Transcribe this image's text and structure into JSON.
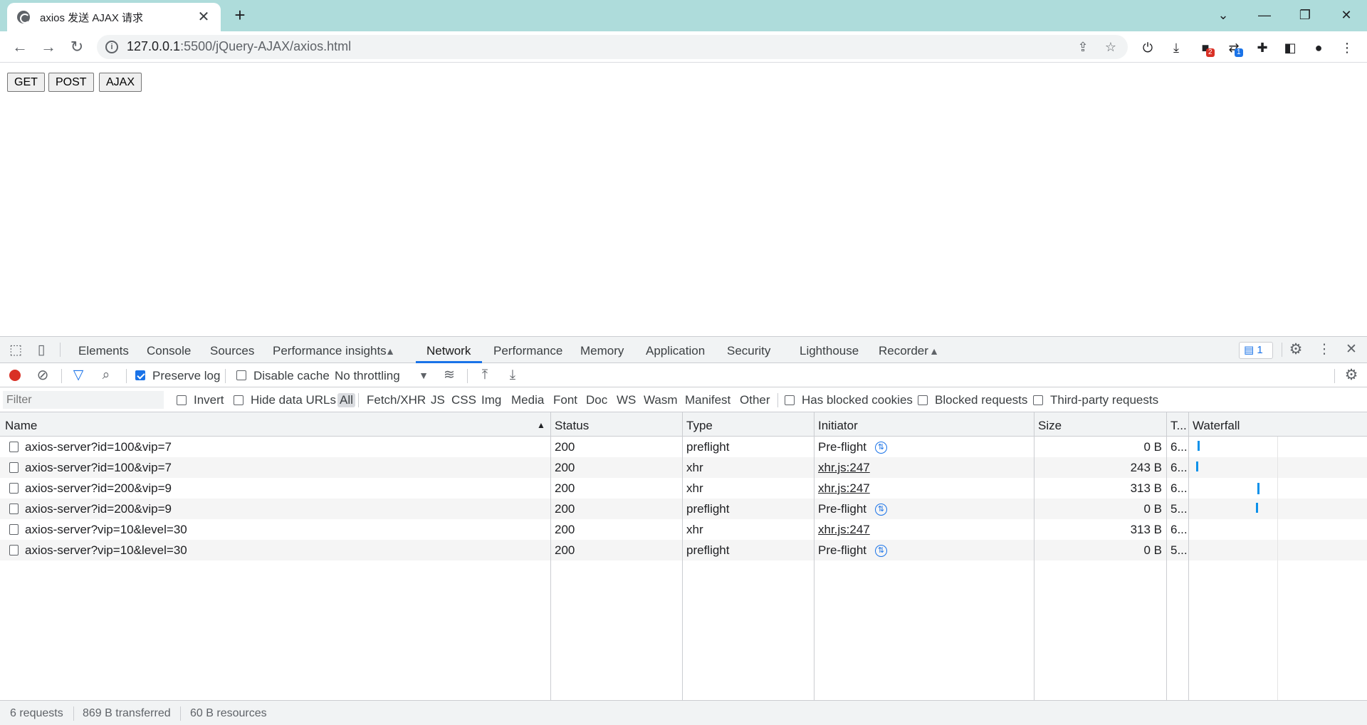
{
  "browser": {
    "tab_title": "axios 发送 AJAX 请求",
    "tab_close": "✕",
    "new_tab": "+",
    "url_host": "127.0.0.1",
    "url_path": ":5500/jQuery-AJAX/axios.html",
    "extension_badges": [
      "2",
      "1"
    ],
    "window_controls": [
      "⌄",
      "—",
      "❐",
      "✕"
    ]
  },
  "page": {
    "buttons": [
      "GET",
      "POST",
      "AJAX"
    ]
  },
  "devtools": {
    "tabs": [
      "Elements",
      "Console",
      "Sources",
      "Performance insights",
      "Network",
      "Performance",
      "Memory",
      "Application",
      "Security",
      "Lighthouse",
      "Recorder"
    ],
    "active_tab": "Network",
    "message_count": "1",
    "toolbar": {
      "preserve_log": "Preserve log",
      "preserve_log_checked": true,
      "disable_cache": "Disable cache",
      "throttling": "No throttling"
    },
    "filter": {
      "placeholder": "Filter",
      "invert": "Invert",
      "hide_data_urls": "Hide data URLs",
      "types": [
        "All",
        "Fetch/XHR",
        "JS",
        "CSS",
        "Img",
        "Media",
        "Font",
        "Doc",
        "WS",
        "Wasm",
        "Manifest",
        "Other"
      ],
      "selected_type": "All",
      "has_blocked_cookies": "Has blocked cookies",
      "blocked_requests": "Blocked requests",
      "third_party": "Third-party requests"
    },
    "table": {
      "columns": [
        "Name",
        "Status",
        "Type",
        "Initiator",
        "Size",
        "T...",
        "Waterfall"
      ],
      "rows": [
        {
          "name": "axios-server?id=100&vip=7",
          "status": "200",
          "type": "preflight",
          "initiator": "Pre-flight",
          "initiator_link": false,
          "size": "0 B",
          "time": "6..."
        },
        {
          "name": "axios-server?id=100&vip=7",
          "status": "200",
          "type": "xhr",
          "initiator": "xhr.js:247",
          "initiator_link": true,
          "size": "243 B",
          "time": "6..."
        },
        {
          "name": "axios-server?id=200&vip=9",
          "status": "200",
          "type": "xhr",
          "initiator": "xhr.js:247",
          "initiator_link": true,
          "size": "313 B",
          "time": "6..."
        },
        {
          "name": "axios-server?id=200&vip=9",
          "status": "200",
          "type": "preflight",
          "initiator": "Pre-flight",
          "initiator_link": false,
          "size": "0 B",
          "time": "5..."
        },
        {
          "name": "axios-server?vip=10&level=30",
          "status": "200",
          "type": "xhr",
          "initiator": "xhr.js:247",
          "initiator_link": true,
          "size": "313 B",
          "time": "6..."
        },
        {
          "name": "axios-server?vip=10&level=30",
          "status": "200",
          "type": "preflight",
          "initiator": "Pre-flight",
          "initiator_link": false,
          "size": "0 B",
          "time": "5..."
        }
      ]
    },
    "status_bar": [
      "6 requests",
      "869 B transferred",
      "60 B resources"
    ]
  },
  "colors": {
    "titlebar": "#aedcdb",
    "accent": "#1a73e8",
    "record": "#d93025",
    "waterfall": "#0b91ea"
  }
}
